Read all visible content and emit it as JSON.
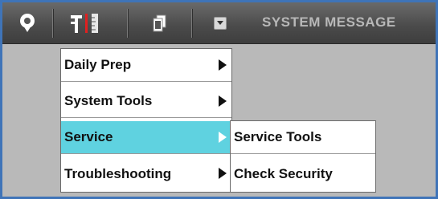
{
  "toolbar": {
    "system_message": "SYSTEM MESSAGE",
    "icons": [
      "location-pin-icon",
      "tools-ruler-icon",
      "copy-icon",
      "dropdown-arrow-icon"
    ]
  },
  "menu": {
    "items": [
      {
        "label": "Daily Prep",
        "has_submenu": true
      },
      {
        "label": "System Tools",
        "has_submenu": true
      },
      {
        "label": "Service",
        "has_submenu": true,
        "active": true
      },
      {
        "label": "Troubleshooting",
        "has_submenu": true
      }
    ]
  },
  "submenu": {
    "items": [
      {
        "label": "Service Tools"
      },
      {
        "label": "Check Security"
      }
    ]
  },
  "colors": {
    "highlight": "#5fd2e0",
    "frame_border": "#3f74b8",
    "background": "#b9b9b9"
  }
}
